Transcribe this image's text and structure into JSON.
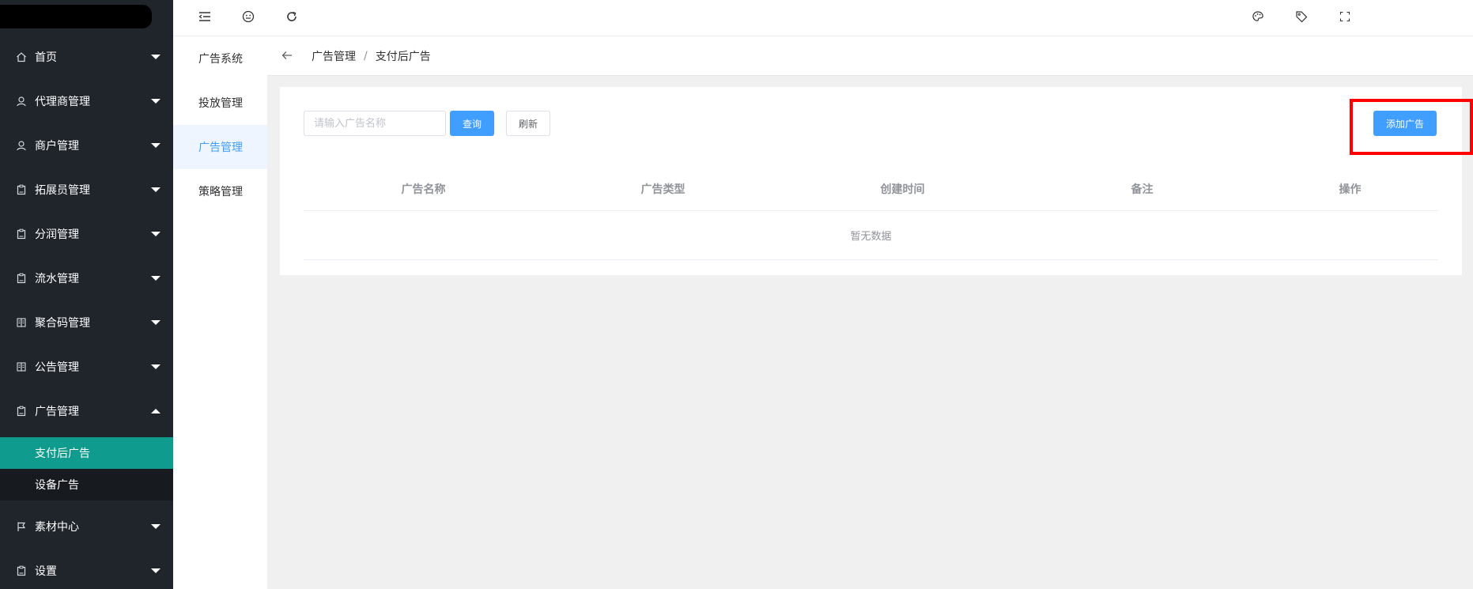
{
  "sidebar": {
    "menu": [
      {
        "label": "首页",
        "icon": "home-icon"
      },
      {
        "label": "代理商管理",
        "icon": "user-icon"
      },
      {
        "label": "商户管理",
        "icon": "user-icon"
      },
      {
        "label": "拓展员管理",
        "icon": "clipboard-icon"
      },
      {
        "label": "分润管理",
        "icon": "clipboard-icon"
      },
      {
        "label": "流水管理",
        "icon": "clipboard-icon"
      },
      {
        "label": "聚合码管理",
        "icon": "document-icon"
      },
      {
        "label": "公告管理",
        "icon": "document-icon"
      },
      {
        "label": "广告管理",
        "icon": "clipboard-icon",
        "expanded": true
      },
      {
        "label": "素材中心",
        "icon": "flag-icon"
      },
      {
        "label": "设置",
        "icon": "clipboard-icon"
      }
    ],
    "submenu": [
      {
        "label": "支付后广告",
        "active": true
      },
      {
        "label": "设备广告",
        "active": false
      }
    ],
    "active_color": "#0f9b8e"
  },
  "secondary_nav": {
    "items": [
      {
        "label": "广告系统",
        "active": false
      },
      {
        "label": "投放管理",
        "active": false
      },
      {
        "label": "广告管理",
        "active": true
      },
      {
        "label": "策略管理",
        "active": false
      }
    ]
  },
  "topbar": {
    "left_icons": [
      "collapse-menu-icon",
      "emoji-icon",
      "refresh-icon"
    ],
    "right_icons": [
      "palette-icon",
      "tag-icon",
      "fullscreen-icon"
    ]
  },
  "breadcrumb": {
    "items": [
      "广告管理",
      "支付后广告"
    ],
    "separator": "/"
  },
  "toolbar": {
    "search_placeholder": "请输入广告名称",
    "search_value": "",
    "query_label": "查询",
    "refresh_label": "刷新",
    "add_label": "添加广告"
  },
  "table": {
    "columns": [
      "广告名称",
      "广告类型",
      "创建时间",
      "备注",
      "操作"
    ],
    "empty_text": "暂无数据",
    "rows": []
  },
  "colors": {
    "primary": "#409eff",
    "sidebar_bg": "#20242b",
    "highlight": "#ff0000"
  }
}
